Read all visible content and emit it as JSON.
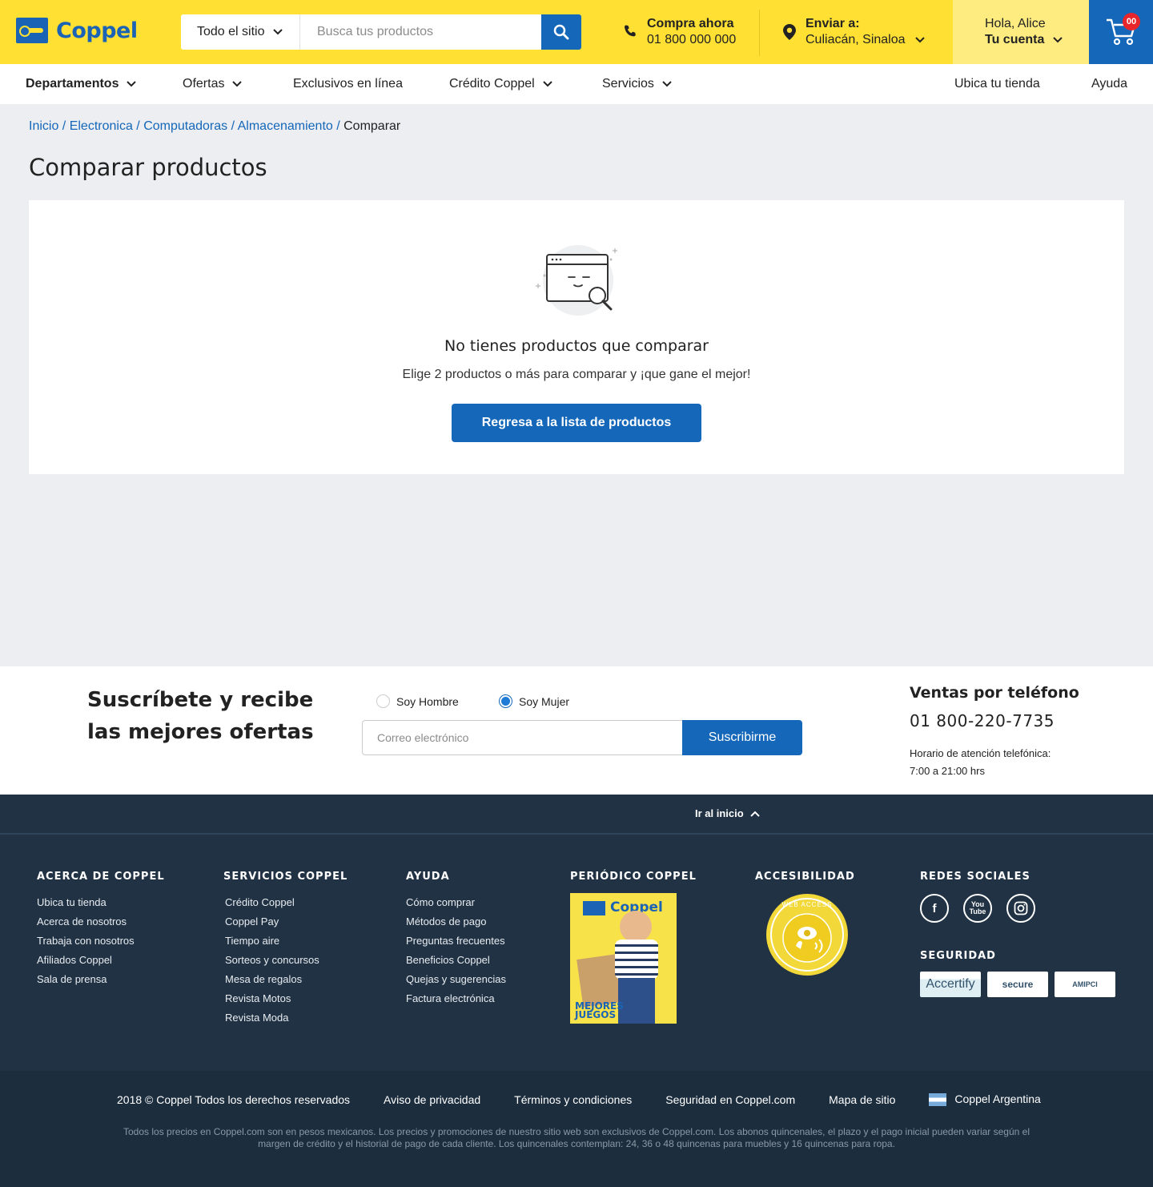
{
  "header": {
    "logo_text": "Coppel",
    "search": {
      "scope": "Todo el sitio",
      "placeholder": "Busca tus productos"
    },
    "call": {
      "title": "Compra ahora",
      "phone": "01 800 000 000"
    },
    "ship": {
      "title": "Enviar a:",
      "location": "Culiacán, Sinaloa"
    },
    "account": {
      "greeting": "Hola, Alice",
      "label": "Tu cuenta"
    },
    "cart": {
      "count": "00"
    }
  },
  "nav": {
    "items": [
      {
        "label": "Departamentos",
        "dropdown": true
      },
      {
        "label": "Ofertas",
        "dropdown": true
      },
      {
        "label": "Exclusivos en línea",
        "dropdown": false
      },
      {
        "label": "Crédito Coppel",
        "dropdown": true
      },
      {
        "label": "Servicios",
        "dropdown": true
      }
    ],
    "right": [
      {
        "label": "Ubica tu tienda"
      },
      {
        "label": "Ayuda"
      }
    ]
  },
  "breadcrumb": {
    "links": [
      "Inicio",
      "Electronica",
      "Computadoras",
      "Almacenamiento"
    ],
    "current": "Comparar"
  },
  "page": {
    "title": "Comparar productos",
    "empty_title": "No tienes productos que comparar",
    "empty_subtitle": "Elige 2 productos o más para comparar y ¡que gane el mejor!",
    "back_button": "Regresa a la lista de productos"
  },
  "newsletter": {
    "title": "Suscríbete y recibe las mejores ofertas",
    "radio_male": "Soy Hombre",
    "radio_female": "Soy Mujer",
    "selected": "Soy Mujer",
    "email_placeholder": "Correo electrónico",
    "subscribe_button": "Suscribirme",
    "phone_title": "Ventas por teléfono",
    "phone_number": "01 800-220-7735",
    "hours_label": "Horario de atención telefónica:",
    "hours_value": "7:00 a 21:00 hrs"
  },
  "footer": {
    "go_top": "Ir al inicio",
    "about": {
      "title": "ACERCA DE COPPEL",
      "items": [
        "Ubica tu tienda",
        "Acerca de nosotros",
        "Trabaja con nosotros",
        "Afiliados Coppel",
        "Sala de prensa"
      ]
    },
    "services": {
      "title": "SERVICIOS COPPEL",
      "items": [
        "Crédito Coppel",
        "Coppel Pay",
        "Tiempo aire",
        "Sorteos y concursos",
        "Mesa de regalos",
        "Revista Motos",
        "Revista Moda"
      ]
    },
    "help": {
      "title": "AYUDA",
      "items": [
        "Cómo comprar",
        "Métodos de pago",
        "Preguntas frecuentes",
        "Beneficios Coppel",
        "Quejas y sugerencias",
        "Factura electrónica"
      ]
    },
    "newspaper": {
      "title": "PERIÓDICO COPPEL",
      "cover_brand": "Coppel",
      "cover_text": "MEJORES JUEGOS"
    },
    "accessibility": {
      "title": "ACCESIBILIDAD",
      "seal_text": "WEB ACCESS"
    },
    "social": {
      "title": "REDES SOCIALES",
      "icons": [
        "facebook-icon",
        "youtube-icon",
        "instagram-icon"
      ]
    },
    "security": {
      "title": "SEGURIDAD",
      "badges": [
        "Accertify",
        "secure",
        "AMIPCI"
      ]
    }
  },
  "legal": {
    "copyright": "2018 © Coppel Todos los derechos reservados",
    "links": [
      "Aviso de privacidad",
      "Términos y condiciones",
      "Seguridad en Coppel.com",
      "Mapa de sitio"
    ],
    "country": "Coppel Argentina",
    "note": "Todos los precios en Coppel.com son en pesos mexicanos. Los precios y promociones de nuestro sitio web son exclusivos de Coppel.com. Los abonos quincenales, el plazo y el pago inicial pueden variar según el margen de crédito y el historial de pago de cada cliente. Los quincenales contemplan: 24, 36 o 48 quincenas para muebles y 16 quincenas para ropa."
  },
  "colors": {
    "brand_yellow": "#ffe033",
    "brand_blue": "#1567b9",
    "footer_navy": "#203244"
  }
}
